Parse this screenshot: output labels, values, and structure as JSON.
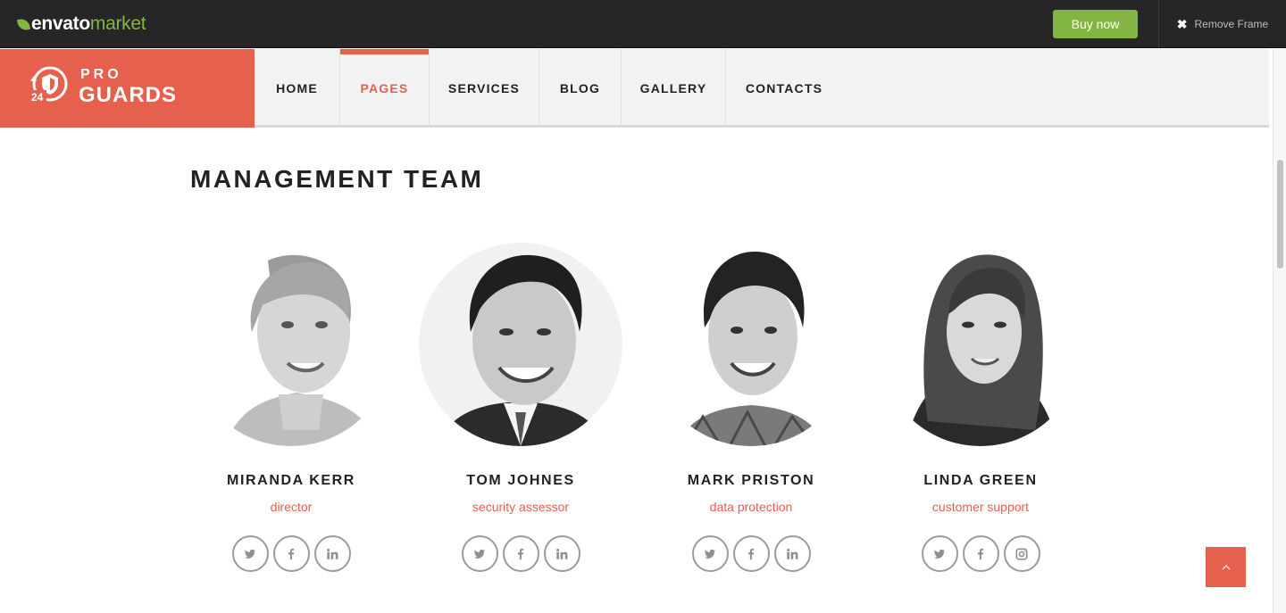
{
  "frame": {
    "logo_envato": "envato",
    "logo_market": "market",
    "buy_label": "Buy now",
    "remove_label": "Remove Frame",
    "accent": "#82b541"
  },
  "header": {
    "logo_top": "PRO",
    "logo_bottom": "GUARDS",
    "logo_badge": "24",
    "brand_color": "#e5604d",
    "nav": [
      {
        "label": "HOME",
        "active": false
      },
      {
        "label": "PAGES",
        "active": true
      },
      {
        "label": "SERVICES",
        "active": false
      },
      {
        "label": "BLOG",
        "active": false
      },
      {
        "label": "GALLERY",
        "active": false
      },
      {
        "label": "CONTACTS",
        "active": false
      }
    ]
  },
  "main": {
    "title": "MANAGEMENT TEAM",
    "team": [
      {
        "name": "MIRANDA KERR",
        "role": "director",
        "socials": [
          "twitter-icon",
          "facebook-icon",
          "linkedin-icon"
        ]
      },
      {
        "name": "TOM JOHNES",
        "role": "security assessor",
        "socials": [
          "twitter-icon",
          "facebook-icon",
          "linkedin-icon"
        ]
      },
      {
        "name": "MARK PRISTON",
        "role": "data protection",
        "socials": [
          "twitter-icon",
          "facebook-icon",
          "linkedin-icon"
        ]
      },
      {
        "name": "LINDA GREEN",
        "role": "customer support",
        "socials": [
          "twitter-icon",
          "facebook-icon",
          "instagram-icon"
        ]
      }
    ]
  },
  "back_to_top": "chevron-up-icon"
}
